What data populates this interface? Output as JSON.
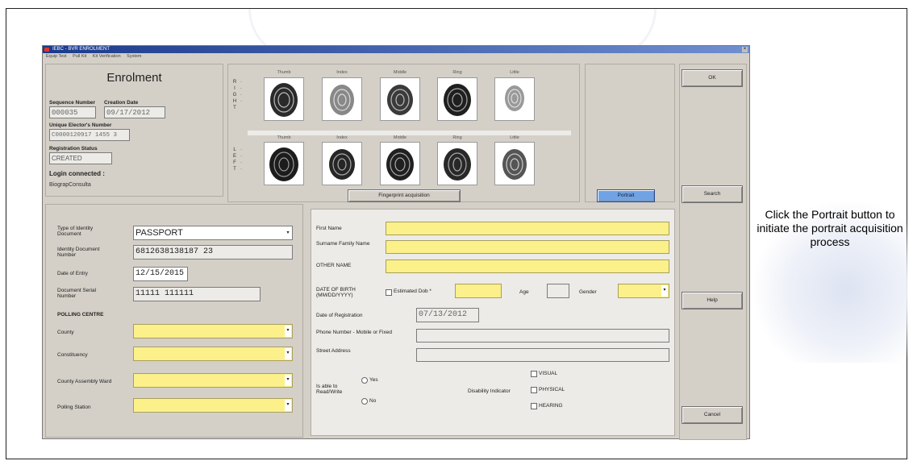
{
  "window": {
    "title": "IEBC - BVR ENROLMENT",
    "menu": [
      "Equip Test",
      "Pull Kit",
      "Kit Verification",
      "System"
    ]
  },
  "enrolment": {
    "title": "Enrolment",
    "sequence_number_label": "Sequence Number",
    "sequence_number": "000035",
    "creation_date_label": "Creation Date",
    "creation_date": "09/17/2012",
    "unique_number_label": "Unique Elector's Number",
    "unique_number": "C0000120917 1455 3",
    "registration_status_label": "Registration Status",
    "registration_status": "CREATED",
    "login_label": "Login connected :",
    "login_value": "BiograpConsulta"
  },
  "fingerprints": {
    "right_hand_label": [
      "R",
      "I",
      "G",
      "H",
      "T"
    ],
    "left_hand_label": [
      "L",
      "E",
      "F",
      "T"
    ],
    "fingers": [
      "Thumb",
      "Index",
      "Middle",
      "Ring",
      "Little"
    ],
    "acquisition_button": "Fingerprint acquisition"
  },
  "portrait": {
    "button": "Portrait"
  },
  "side_buttons": {
    "ok": "OK",
    "search": "Search",
    "help": "Help",
    "cancel": "Cancel"
  },
  "identity": {
    "doc_type_label": "Type of Identity Document",
    "doc_type": "PASSPORT",
    "id_number_label": "Identity Document Number",
    "id_number": "6812638138187 23",
    "date_of_entry_label": "Date of Entry",
    "date_of_entry": "12/15/2015",
    "serial_label": "Document Serial Number",
    "serial": "11111 111111",
    "polling_centre_label": "POLLING CENTRE",
    "county_label": "County",
    "constituency_label": "Constituency",
    "ward_label": "County Assembly Ward",
    "station_label": "Polling Station"
  },
  "personal": {
    "first_name_label": "First Name",
    "surname_label": "Surname Family Name",
    "other_name_label": "OTHER NAME",
    "dob_label": "DATE OF BIRTH (MM/DD/YYYY)",
    "estimated_dob_label": "Estimated Dob *",
    "age_label": "Age",
    "gender_label": "Gender",
    "reg_date_label": "Date of Registration",
    "reg_date": "07/13/2012",
    "phone_label": "Phone Number - Mobile or Fixed",
    "address_label": "Street Address",
    "literate_label": "Is able to Read/Write",
    "literate_yes": "Yes",
    "literate_no": "No",
    "disability_label": "Disability Indicator",
    "disability_options": [
      "VISUAL",
      "PHYSICAL",
      "HEARING"
    ]
  },
  "instruction_text": "Click the Portrait button to initiate the portrait acquisition process"
}
